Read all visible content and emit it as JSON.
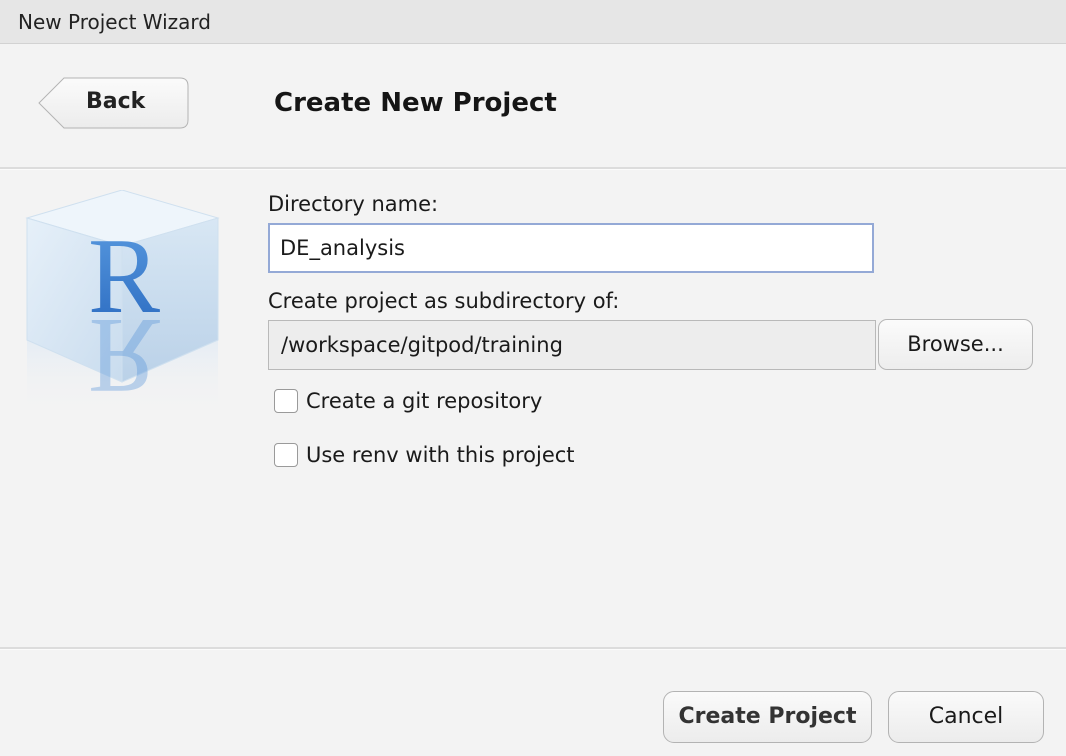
{
  "window": {
    "title": "New Project Wizard"
  },
  "header": {
    "back_label": "Back",
    "title": "Create New Project"
  },
  "form": {
    "directory_label": "Directory name:",
    "directory_value": "DE_analysis",
    "parent_label": "Create project as subdirectory of:",
    "parent_value": "/workspace/gitpod/training",
    "browse_label": "Browse...",
    "git_label": "Create a git repository",
    "git_checked": false,
    "renv_label": "Use renv with this project",
    "renv_checked": false
  },
  "footer": {
    "create_label": "Create Project",
    "cancel_label": "Cancel"
  },
  "logo": {
    "letter": "R",
    "icon": "r-logo-cube-icon"
  },
  "colors": {
    "input_focus_border": "#94a9d6",
    "r_blue": "#2f74c6",
    "background": "#f3f3f3"
  }
}
